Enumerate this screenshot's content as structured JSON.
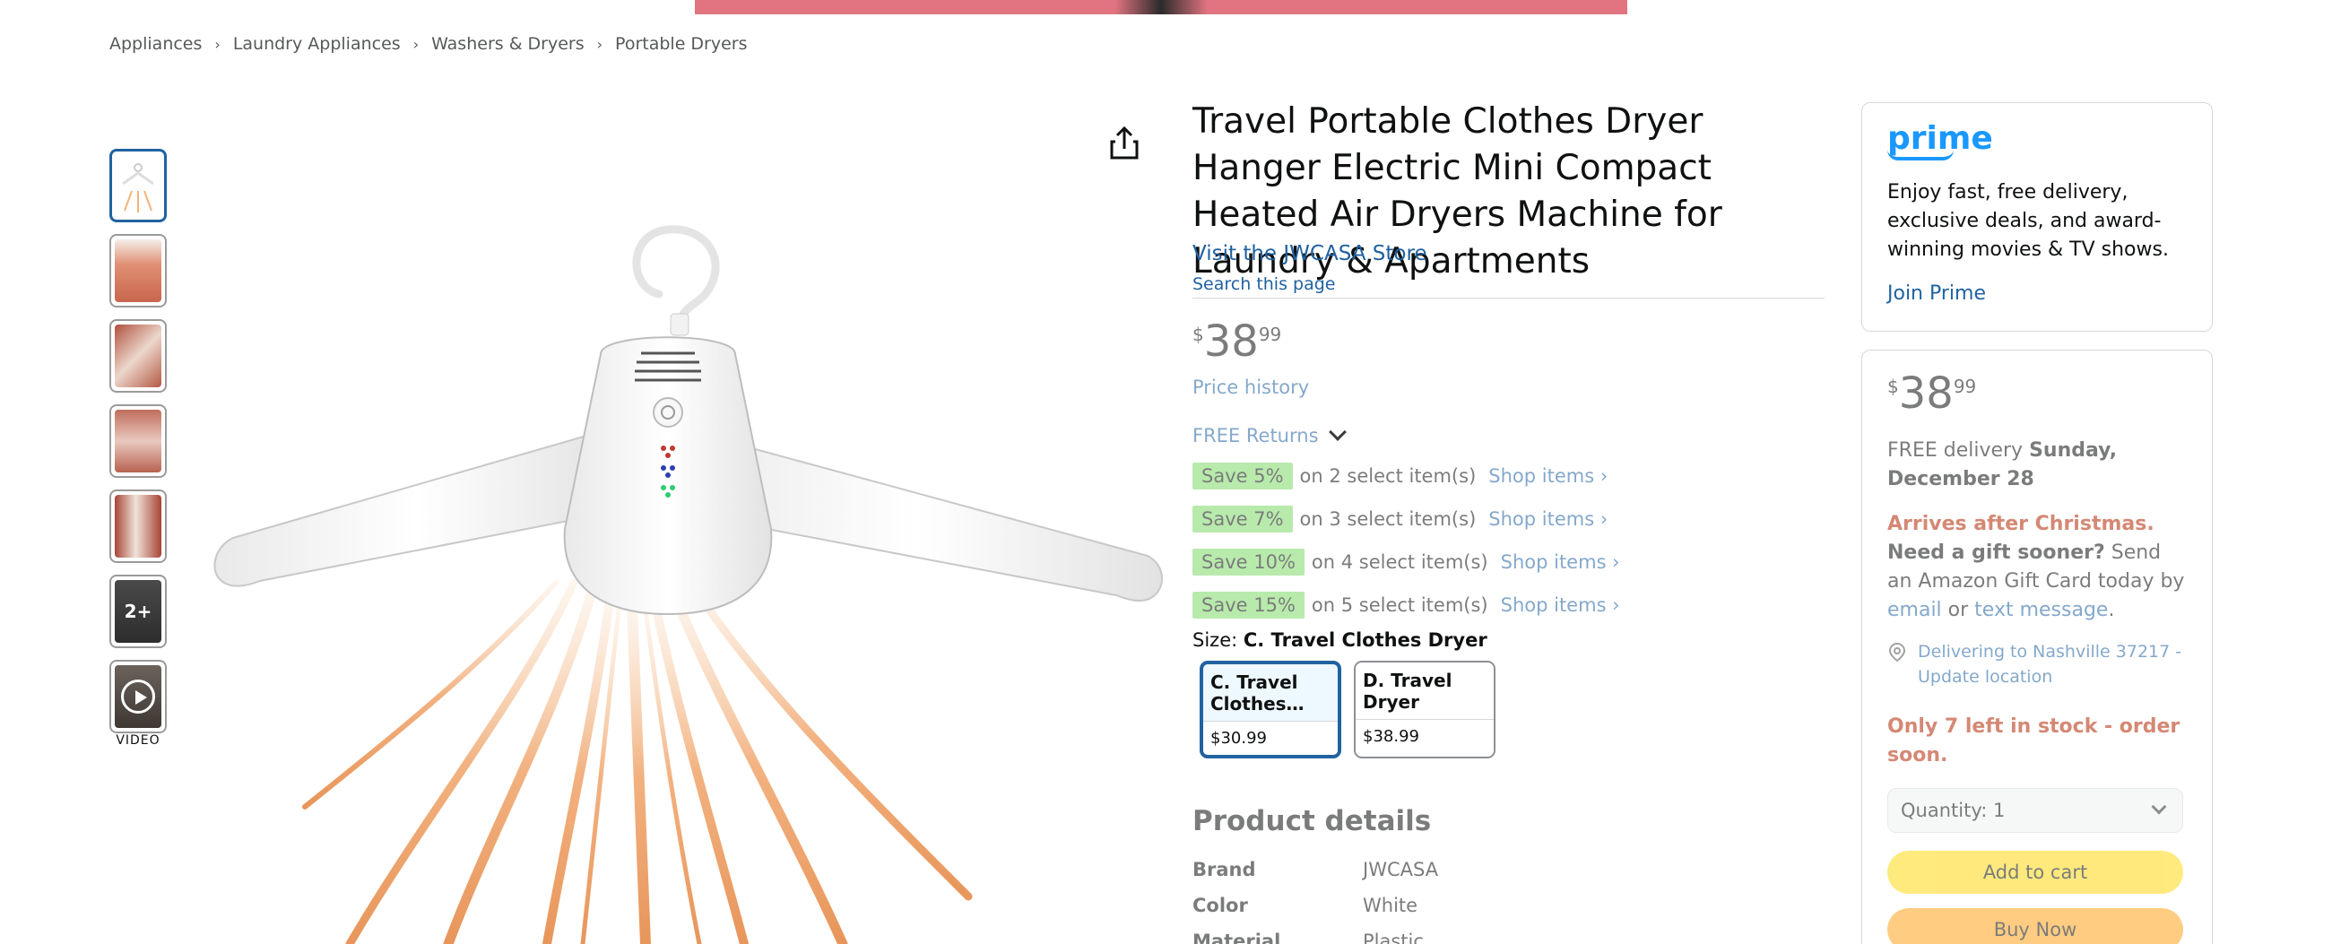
{
  "breadcrumb": [
    "Appliances",
    "Laundry Appliances",
    "Washers & Dryers",
    "Portable Dryers"
  ],
  "breadcrumb_separator": "›",
  "thumbnails": {
    "more_label": "2+",
    "video_label": "VIDEO"
  },
  "product": {
    "title": "Travel Portable Clothes Dryer Hanger Electric Mini Compact Heated Air Dryers Machine for Laundry & Apartments",
    "store_link": "Visit the JWCASA Store",
    "search_page": "Search this page",
    "price": {
      "symbol": "$",
      "whole": "38",
      "fraction": "99"
    },
    "price_history": "Price history",
    "free_returns": "FREE Returns",
    "promos": [
      {
        "badge": "Save 5%",
        "text": "on 2 select item(s)",
        "link": "Shop items ›"
      },
      {
        "badge": "Save 7%",
        "text": "on 3 select item(s)",
        "link": "Shop items ›"
      },
      {
        "badge": "Save 10%",
        "text": "on 4 select item(s)",
        "link": "Shop items ›"
      },
      {
        "badge": "Save 15%",
        "text": "on 5 select item(s)",
        "link": "Shop items ›"
      }
    ],
    "size_label": "Size: ",
    "size_selected": "C. Travel Clothes Dryer",
    "size_options": [
      {
        "name": "C. Travel Clothes…",
        "price": "$30.99"
      },
      {
        "name": "D. Travel Dryer",
        "price": "$38.99"
      }
    ]
  },
  "details": {
    "title": "Product details",
    "rows": [
      {
        "key": "Brand",
        "value": "JWCASA"
      },
      {
        "key": "Color",
        "value": "White"
      },
      {
        "key": "Material",
        "value": "Plastic"
      }
    ]
  },
  "prime": {
    "logo": "prime",
    "text": "Enjoy fast, free delivery, exclusive deals, and award-winning movies & TV shows.",
    "join": "Join Prime"
  },
  "buybox": {
    "price": {
      "symbol": "$",
      "whole": "38",
      "fraction": "99"
    },
    "delivery_prefix": "FREE delivery ",
    "delivery_date": "Sunday, December 28",
    "arrives_red": "Arrives after Christmas.",
    "need_gift": " Need a gift sooner?",
    "send_text": " Send an Amazon Gift Card today by ",
    "email_link": "email",
    "or_text": " or ",
    "text_link": "text message",
    "period": ".",
    "location": "Delivering to Nashville 37217 - Update location",
    "stock": "Only 7 left in stock - order soon.",
    "quantity_label": "Quantity:",
    "quantity_value": "1",
    "add_to_cart": "Add to cart",
    "buy_now": "Buy Now"
  },
  "colors": {
    "link": "#2162a1",
    "price_red": "#b12704",
    "promo_green": "#7fda69",
    "cart_yellow": "#ffd814",
    "buy_orange": "#ffa41c",
    "prime_blue": "#1a98ff",
    "selected_border": "#2162a1"
  }
}
